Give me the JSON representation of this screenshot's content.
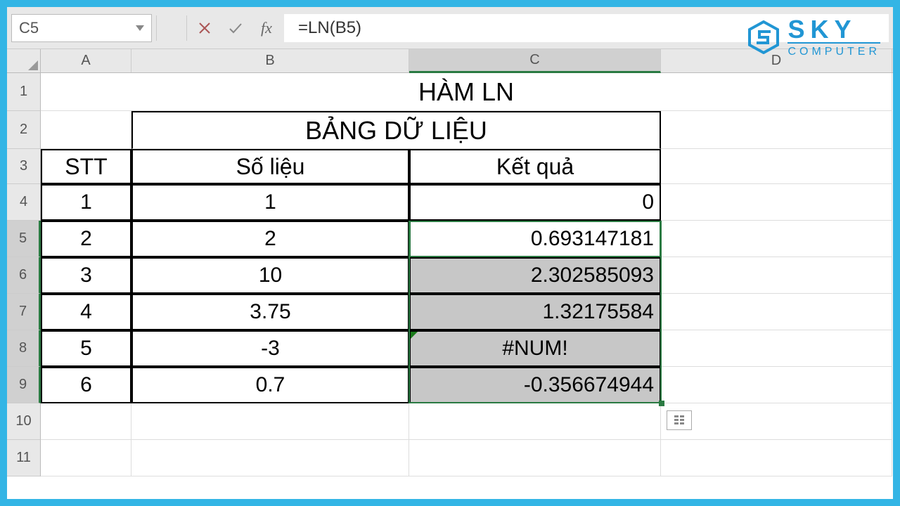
{
  "name_box": "C5",
  "formula": "=LN(B5)",
  "fx_label": "fx",
  "columns": [
    "A",
    "B",
    "C",
    "D"
  ],
  "rows": [
    "1",
    "2",
    "3",
    "4",
    "5",
    "6",
    "7",
    "8",
    "9",
    "10",
    "11"
  ],
  "title": "HÀM LN",
  "subtitle": "BẢNG DỮ LIỆU",
  "headers": {
    "a": "STT",
    "b": "Số liệu",
    "c": "Kết quả"
  },
  "data": [
    {
      "stt": "1",
      "val": "1",
      "res": "0"
    },
    {
      "stt": "2",
      "val": "2",
      "res": "0.693147181"
    },
    {
      "stt": "3",
      "val": "10",
      "res": "2.302585093"
    },
    {
      "stt": "4",
      "val": "3.75",
      "res": "1.32175584"
    },
    {
      "stt": "5",
      "val": "-3",
      "res": "#NUM!"
    },
    {
      "stt": "6",
      "val": "0.7",
      "res": "-0.356674944"
    }
  ],
  "logo": {
    "line1": "SKY",
    "line2": "COMPUTER"
  },
  "chart_data": {
    "type": "table",
    "title": "HÀM LN — BẢNG DỮ LIỆU",
    "columns": [
      "STT",
      "Số liệu",
      "Kết quả"
    ],
    "rows": [
      [
        1,
        1,
        0
      ],
      [
        2,
        2,
        0.693147181
      ],
      [
        3,
        10,
        2.302585093
      ],
      [
        4,
        3.75,
        1.32175584
      ],
      [
        5,
        -3,
        "#NUM!"
      ],
      [
        6,
        0.7,
        -0.356674944
      ]
    ]
  }
}
